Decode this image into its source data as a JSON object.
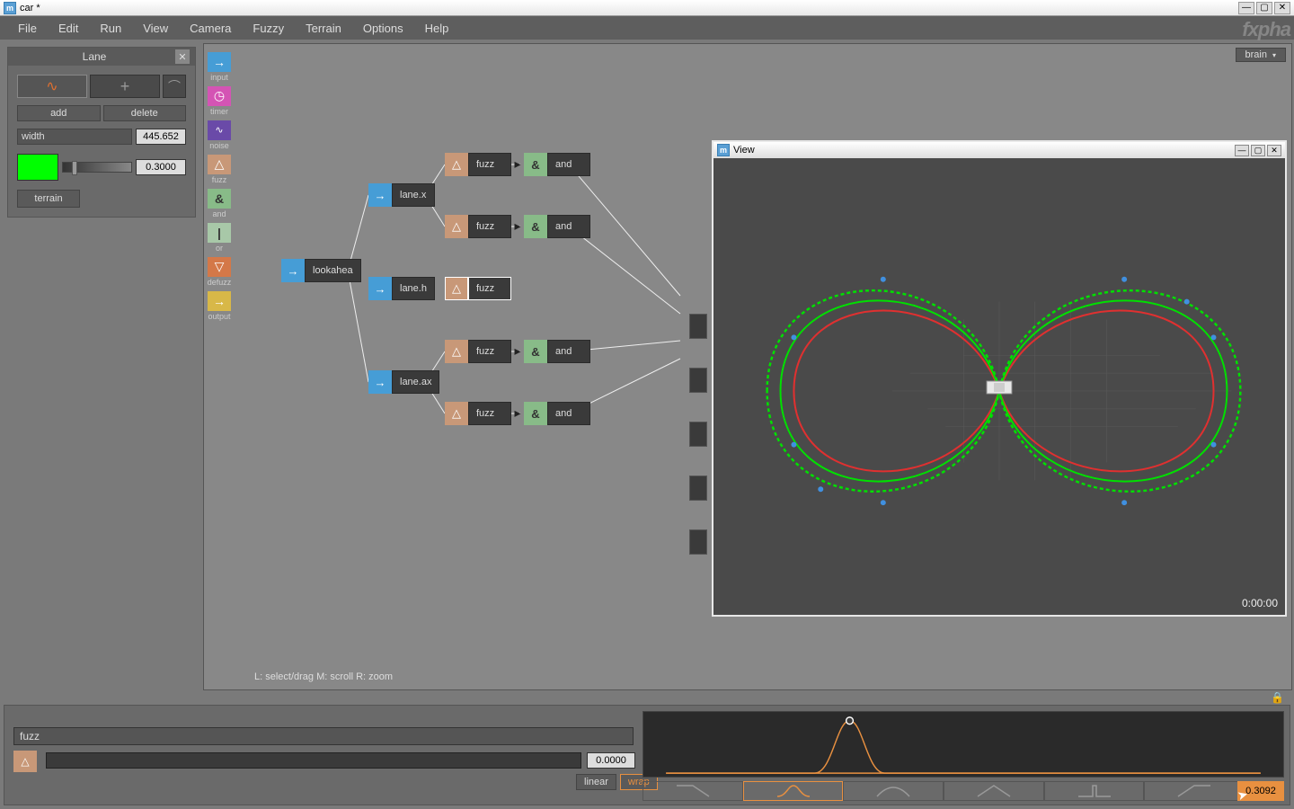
{
  "window": {
    "title": "car *",
    "app_icon_letter": "m"
  },
  "menu": [
    "File",
    "Edit",
    "Run",
    "View",
    "Camera",
    "Fuzzy",
    "Terrain",
    "Options",
    "Help"
  ],
  "logo": "fxpha",
  "view_mode": "brain",
  "panel": {
    "title": "Lane",
    "add": "add",
    "delete": "delete",
    "width_label": "width",
    "width_value": "445.652",
    "color_value": "0.3000",
    "terrain": "terrain"
  },
  "palette": [
    {
      "name": "input",
      "label": "input",
      "glyph": "→",
      "cls": "pal-input"
    },
    {
      "name": "timer",
      "label": "timer",
      "glyph": "◷",
      "cls": "pal-timer"
    },
    {
      "name": "noise",
      "label": "noise",
      "glyph": "∿",
      "cls": "pal-noise"
    },
    {
      "name": "fuzz",
      "label": "fuzz",
      "glyph": "△",
      "cls": "pal-fuzz"
    },
    {
      "name": "and",
      "label": "and",
      "glyph": "&",
      "cls": "pal-and"
    },
    {
      "name": "or",
      "label": "or",
      "glyph": "|",
      "cls": "pal-or"
    },
    {
      "name": "defuzz",
      "label": "defuzz",
      "glyph": "▽",
      "cls": "pal-defuzz"
    },
    {
      "name": "output",
      "label": "output",
      "glyph": "→",
      "cls": "pal-output"
    }
  ],
  "nodes": {
    "lookahead": "lookahea",
    "lanex": "lane.x",
    "laneh": "lane.h",
    "laneax": "lane.ax",
    "fuzz": "fuzz",
    "and": "and"
  },
  "status_hint": "L: select/drag  M: scroll  R: zoom",
  "view_window": {
    "title": "View",
    "timecode": "0:00:00"
  },
  "bottom": {
    "label": "fuzz",
    "slider_value": "0.0000",
    "output_value": "0.3092",
    "linear": "linear",
    "wrap": "wrap"
  }
}
